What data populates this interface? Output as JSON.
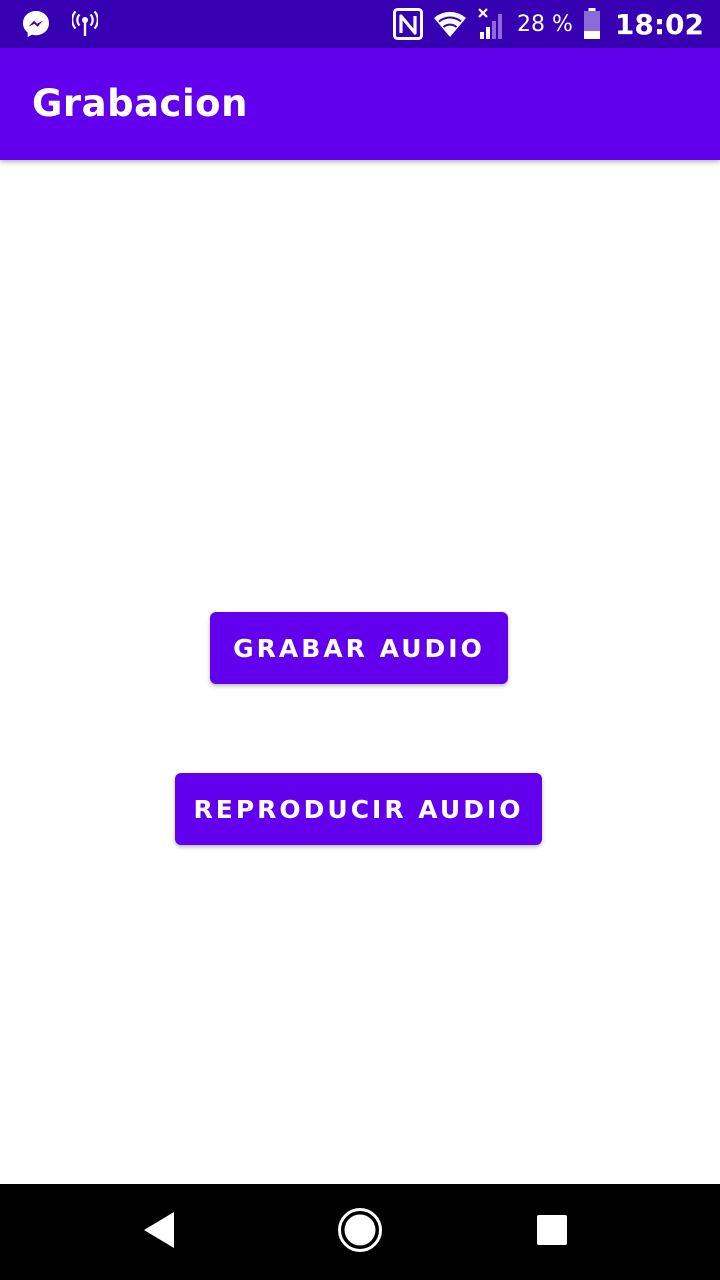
{
  "status_bar": {
    "battery_percent": "28 %",
    "time": "18:02",
    "icons": [
      "messenger-icon",
      "hotspot-icon",
      "nfc-icon",
      "wifi-icon",
      "cell-signal-icon",
      "battery-icon"
    ]
  },
  "app_bar": {
    "title": "Grabacion"
  },
  "main": {
    "record_button_label": "GRABAR AUDIO",
    "play_button_label": "REPRODUCIR AUDIO"
  },
  "nav_bar": {
    "icons": [
      "back-icon",
      "home-icon",
      "recents-icon"
    ]
  },
  "colors": {
    "status_bar": "#3700b3",
    "primary": "#6200ee",
    "background": "#ffffff",
    "nav_bar": "#000000"
  }
}
